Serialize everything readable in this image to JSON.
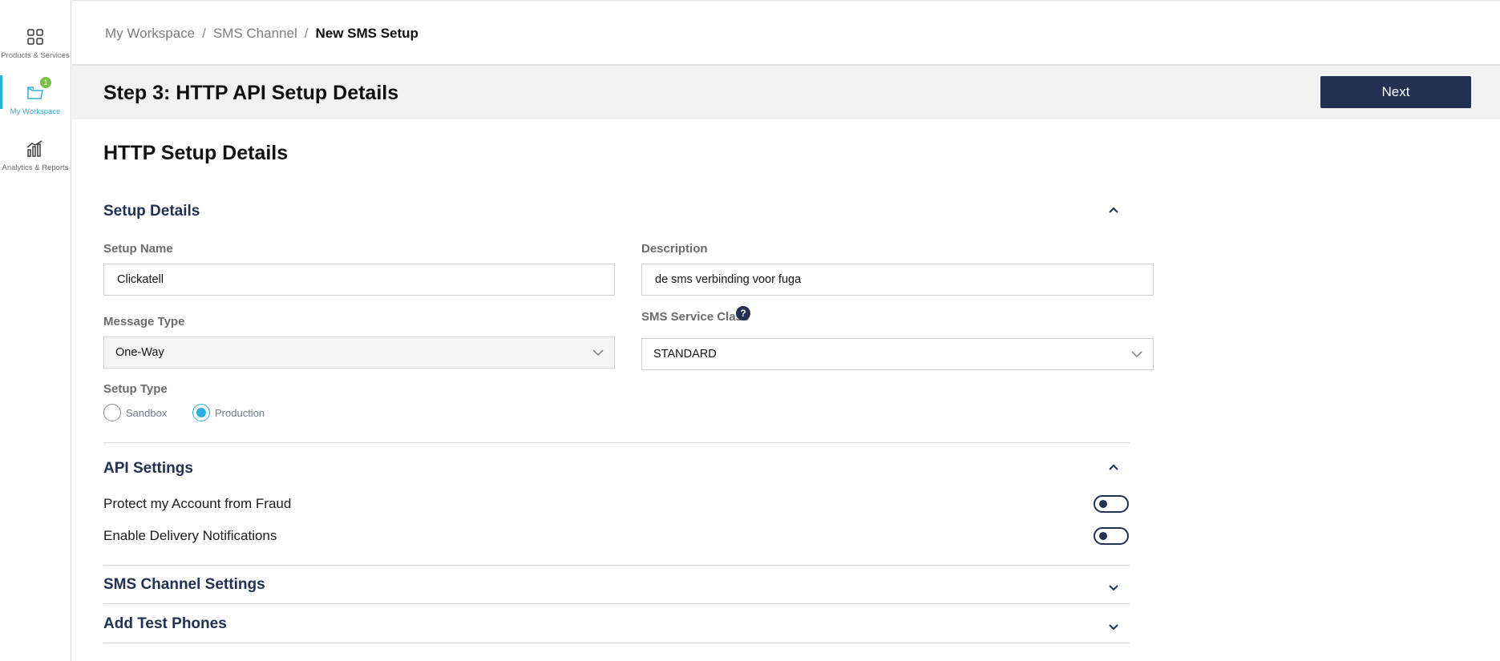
{
  "rail": {
    "items": [
      {
        "label": "Products & Services",
        "icon": "grid-icon",
        "active": false
      },
      {
        "label": "My Workspace",
        "icon": "folder-icon",
        "active": true,
        "badge": "1"
      },
      {
        "label": "Analytics & Reports",
        "icon": "bar-chart-icon",
        "active": false
      }
    ]
  },
  "breadcrumb": {
    "items": [
      "My Workspace",
      "SMS Channel"
    ],
    "separator": "/",
    "current": "New SMS Setup"
  },
  "step": {
    "title": "Step 3: HTTP API Setup Details",
    "next_label": "Next"
  },
  "page": {
    "title": "HTTP Setup Details"
  },
  "setup_details": {
    "title": "Setup Details",
    "setup_name_label": "Setup Name",
    "setup_name_value": "Clickatell",
    "description_label": "Description",
    "description_value": "de sms verbinding voor fuga",
    "message_type_label": "Message Type",
    "message_type_value": "One-Way",
    "service_class_label": "SMS Service Class",
    "service_class_value": "STANDARD",
    "help_glyph": "?",
    "setup_type_label": "Setup Type",
    "setup_type_options": [
      "Sandbox",
      "Production"
    ],
    "setup_type_selected": "Production"
  },
  "api_settings": {
    "title": "API Settings",
    "toggles": [
      {
        "label": "Protect my Account from Fraud",
        "enabled": false
      },
      {
        "label": "Enable Delivery Notifications",
        "enabled": false
      }
    ]
  },
  "sms_channel_settings": {
    "title": "SMS Channel Settings"
  },
  "test_phones": {
    "title": "Add Test Phones"
  },
  "colors": {
    "accent": "#2ab0de",
    "navy": "#223152",
    "badge": "#7bc043"
  }
}
